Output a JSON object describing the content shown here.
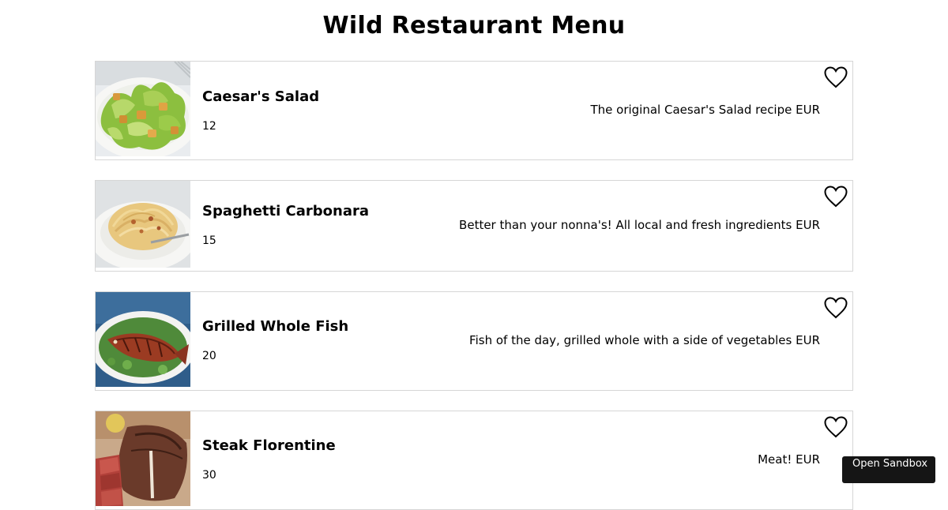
{
  "page": {
    "title": "Wild Restaurant Menu"
  },
  "menu": {
    "items": [
      {
        "name": "Caesar's Salad",
        "price": "12",
        "description": "The original Caesar's Salad recipe EUR",
        "favorite_icon": "heart-outline-icon",
        "photo": "caesar-salad-photo"
      },
      {
        "name": "Spaghetti Carbonara",
        "price": "15",
        "description": "Better than your nonna's! All local and fresh ingredients EUR",
        "favorite_icon": "heart-outline-icon",
        "photo": "spaghetti-carbonara-photo"
      },
      {
        "name": "Grilled Whole Fish",
        "price": "20",
        "description": "Fish of the day, grilled whole with a side of vegetables EUR",
        "favorite_icon": "heart-outline-icon",
        "photo": "grilled-fish-photo"
      },
      {
        "name": "Steak Florentine",
        "price": "30",
        "description": "Meat! EUR",
        "favorite_icon": "heart-outline-icon",
        "photo": "steak-florentine-photo"
      }
    ]
  },
  "sandbox": {
    "label": "Open Sandbox"
  },
  "colors": {
    "card_border": "#d6d6d6",
    "text": "#000000",
    "sandbox_background": "#151515",
    "sandbox_text": "#ffffff"
  }
}
